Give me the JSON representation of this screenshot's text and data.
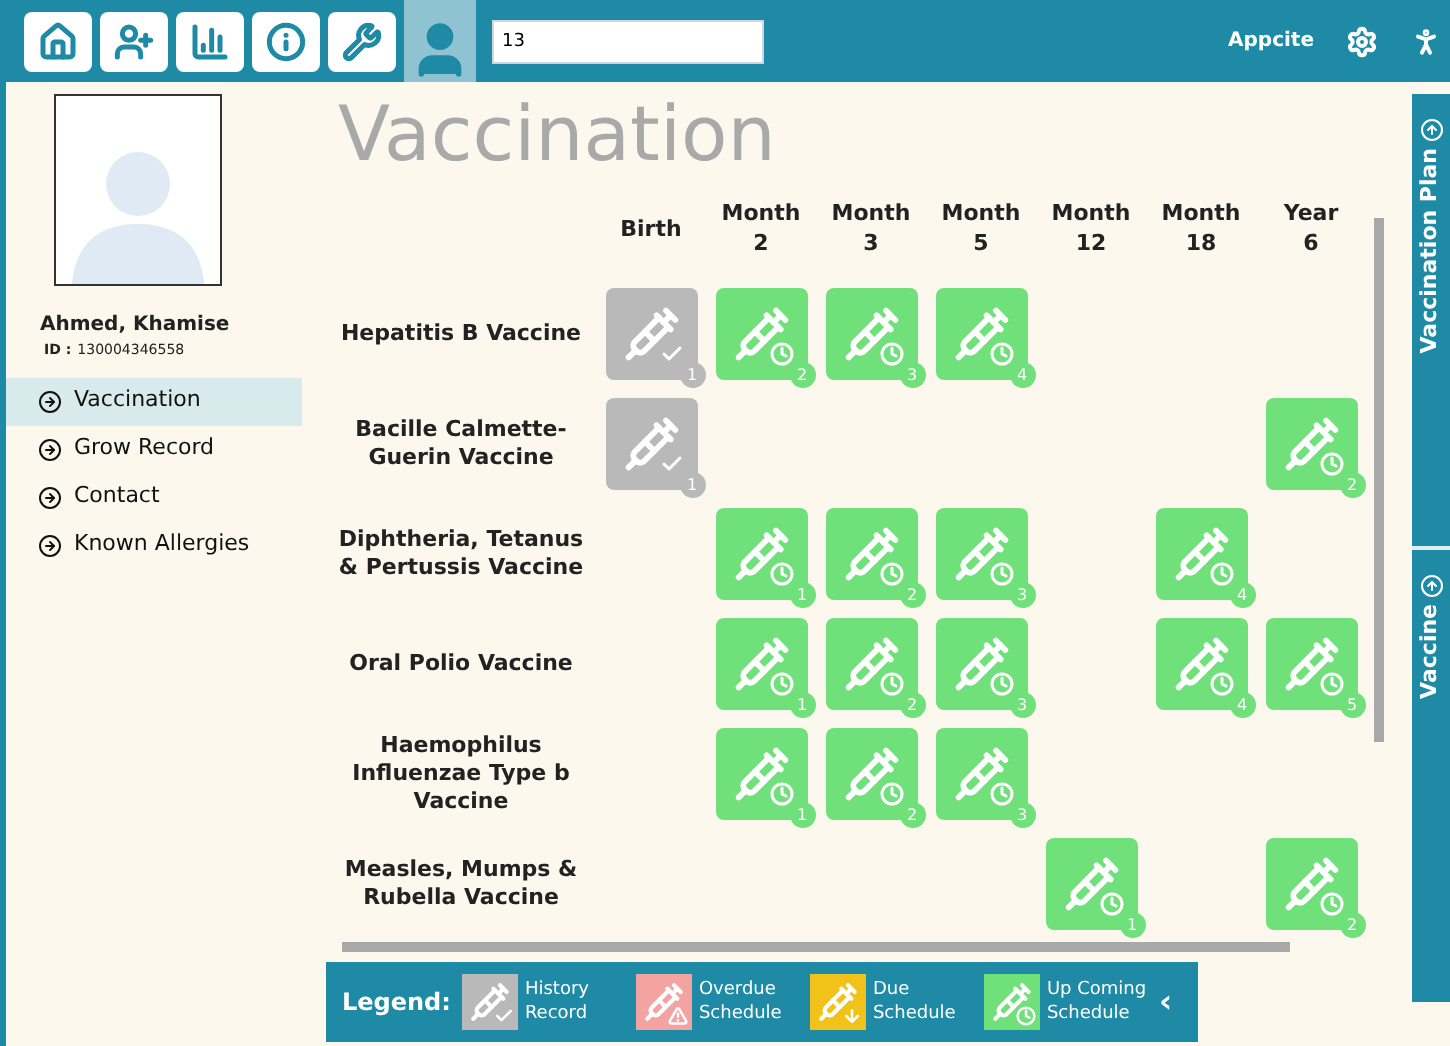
{
  "toolbar": {
    "search_value": "13",
    "app_name": "Appcite"
  },
  "patient": {
    "name": "Ahmed, Khamise",
    "id_label": "ID :",
    "id": "130004346558"
  },
  "nav": [
    {
      "label": "Vaccination",
      "selected": true
    },
    {
      "label": "Grow Record",
      "selected": false
    },
    {
      "label": "Contact",
      "selected": false
    },
    {
      "label": "Known Allergies",
      "selected": false
    }
  ],
  "title": "Vaccination",
  "columns": [
    [
      "Birth"
    ],
    [
      "Month",
      "2"
    ],
    [
      "Month",
      "3"
    ],
    [
      "Month",
      "5"
    ],
    [
      "Month",
      "12"
    ],
    [
      "Month",
      "18"
    ],
    [
      "Year",
      "6"
    ]
  ],
  "rows": [
    {
      "name": "Hepatitis B Vaccine",
      "doses": [
        {
          "kind": "history",
          "dose": "1"
        },
        {
          "kind": "upcoming",
          "dose": "2"
        },
        {
          "kind": "upcoming",
          "dose": "3"
        },
        {
          "kind": "upcoming",
          "dose": "4"
        },
        {
          "kind": "empty"
        },
        {
          "kind": "empty"
        },
        {
          "kind": "empty"
        }
      ]
    },
    {
      "name": "Bacille Calmette-Guerin Vaccine",
      "doses": [
        {
          "kind": "history",
          "dose": "1"
        },
        {
          "kind": "empty"
        },
        {
          "kind": "empty"
        },
        {
          "kind": "empty"
        },
        {
          "kind": "empty"
        },
        {
          "kind": "empty"
        },
        {
          "kind": "upcoming",
          "dose": "2"
        }
      ]
    },
    {
      "name": "Diphtheria, Tetanus & Pertussis Vaccine",
      "doses": [
        {
          "kind": "empty"
        },
        {
          "kind": "upcoming",
          "dose": "1"
        },
        {
          "kind": "upcoming",
          "dose": "2"
        },
        {
          "kind": "upcoming",
          "dose": "3"
        },
        {
          "kind": "empty"
        },
        {
          "kind": "upcoming",
          "dose": "4"
        },
        {
          "kind": "empty"
        }
      ]
    },
    {
      "name": "Oral Polio Vaccine",
      "doses": [
        {
          "kind": "empty"
        },
        {
          "kind": "upcoming",
          "dose": "1"
        },
        {
          "kind": "upcoming",
          "dose": "2"
        },
        {
          "kind": "upcoming",
          "dose": "3"
        },
        {
          "kind": "empty"
        },
        {
          "kind": "upcoming",
          "dose": "4"
        },
        {
          "kind": "upcoming",
          "dose": "5"
        }
      ]
    },
    {
      "name": "Haemophilus Influenzae Type b Vaccine",
      "doses": [
        {
          "kind": "empty"
        },
        {
          "kind": "upcoming",
          "dose": "1"
        },
        {
          "kind": "upcoming",
          "dose": "2"
        },
        {
          "kind": "upcoming",
          "dose": "3"
        },
        {
          "kind": "empty"
        },
        {
          "kind": "empty"
        },
        {
          "kind": "empty"
        }
      ]
    },
    {
      "name": "Measles, Mumps & Rubella Vaccine",
      "doses": [
        {
          "kind": "empty"
        },
        {
          "kind": "empty"
        },
        {
          "kind": "empty"
        },
        {
          "kind": "empty"
        },
        {
          "kind": "upcoming",
          "dose": "1"
        },
        {
          "kind": "empty"
        },
        {
          "kind": "upcoming",
          "dose": "2"
        }
      ]
    }
  ],
  "legend": {
    "title": "Legend:",
    "items": [
      {
        "kind": "history",
        "lines": [
          "History",
          "Record"
        ]
      },
      {
        "kind": "overdue",
        "lines": [
          "Overdue",
          "Schedule"
        ]
      },
      {
        "kind": "due",
        "lines": [
          "Due",
          "Schedule"
        ]
      },
      {
        "kind": "upcoming",
        "lines": [
          "Up Coming",
          "Schedule"
        ]
      }
    ],
    "collapse": "‹"
  },
  "side_tabs": [
    {
      "label": "Vaccination Plan"
    },
    {
      "label": "Vaccine"
    }
  ]
}
